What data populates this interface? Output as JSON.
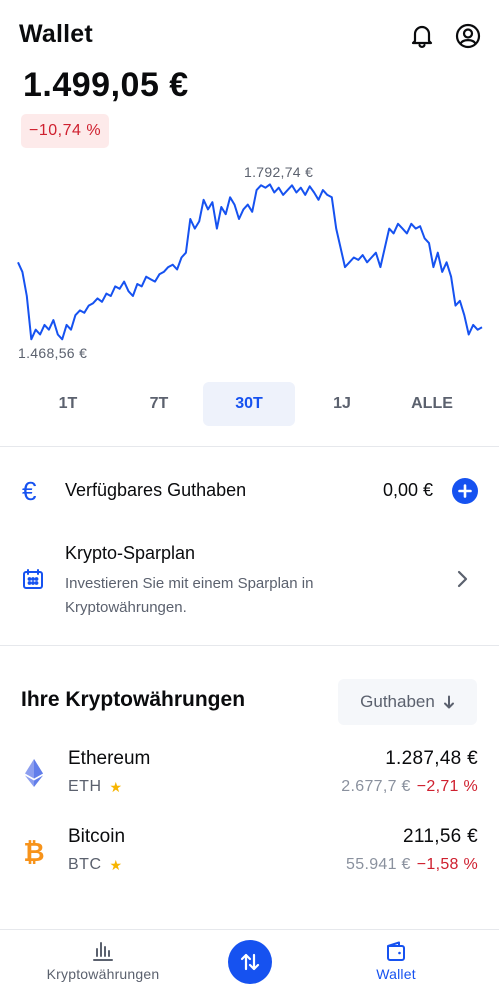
{
  "header": {
    "title": "Wallet",
    "bell_icon": "bell-icon",
    "profile_icon": "user-circle-icon"
  },
  "portfolio": {
    "balance": "1.499,05 €",
    "change": "−10,74 %"
  },
  "chart_data": {
    "type": "line",
    "period": "30T",
    "max_label": "1.792,74 €",
    "min_label": "1.468,56 €",
    "ylim": [
      1468.56,
      1792.74
    ],
    "values": [
      1630,
      1610,
      1560,
      1470,
      1490,
      1480,
      1500,
      1490,
      1510,
      1480,
      1470,
      1500,
      1490,
      1520,
      1530,
      1525,
      1540,
      1545,
      1555,
      1548,
      1565,
      1560,
      1580,
      1575,
      1590,
      1570,
      1560,
      1585,
      1580,
      1600,
      1595,
      1590,
      1605,
      1610,
      1620,
      1625,
      1615,
      1640,
      1650,
      1720,
      1700,
      1715,
      1760,
      1740,
      1755,
      1700,
      1745,
      1730,
      1765,
      1750,
      1720,
      1740,
      1750,
      1735,
      1780,
      1790,
      1785,
      1792,
      1775,
      1785,
      1770,
      1780,
      1790,
      1775,
      1785,
      1770,
      1788,
      1775,
      1760,
      1780,
      1770,
      1765,
      1700,
      1660,
      1620,
      1630,
      1640,
      1635,
      1645,
      1630,
      1640,
      1650,
      1620,
      1660,
      1700,
      1690,
      1710,
      1700,
      1690,
      1710,
      1700,
      1705,
      1680,
      1670,
      1620,
      1650,
      1610,
      1630,
      1600,
      1540,
      1550,
      1520,
      1480,
      1500,
      1490,
      1495
    ]
  },
  "ranges": [
    {
      "label": "1T",
      "active": false
    },
    {
      "label": "7T",
      "active": false
    },
    {
      "label": "30T",
      "active": true
    },
    {
      "label": "1J",
      "active": false
    },
    {
      "label": "ALLE",
      "active": false
    }
  ],
  "fiat": {
    "label": "Verfügbares Guthaben",
    "value": "0,00 €",
    "icon": "euro-icon",
    "add_icon": "plus-icon"
  },
  "savings_plan": {
    "title": "Krypto-Sparplan",
    "description": "Investieren Sie mit einem Sparplan in Kryptowährungen.",
    "icon": "calendar-icon"
  },
  "assets_section": {
    "title": "Ihre Kryptowährungen",
    "sort_label": "Guthaben",
    "sort_icon": "arrow-down-icon"
  },
  "assets": [
    {
      "name": "Ethereum",
      "symbol": "ETH",
      "value": "1.287,48 €",
      "price": "2.677,7 €",
      "change": "−2,71 %",
      "icon": "ethereum-icon",
      "color": "#627eea"
    },
    {
      "name": "Bitcoin",
      "symbol": "BTC",
      "value": "211,56 €",
      "price": "55.941 €",
      "change": "−1,58 %",
      "icon": "bitcoin-icon",
      "color": "#f7931a"
    }
  ],
  "tabbar": {
    "crypto_label": "Kryptowährungen",
    "wallet_label": "Wallet",
    "trade_icon": "swap-arrows-icon"
  },
  "colors": {
    "accent": "#1652f0",
    "negative": "#cf202f",
    "negative_bg": "#fdeaea"
  }
}
